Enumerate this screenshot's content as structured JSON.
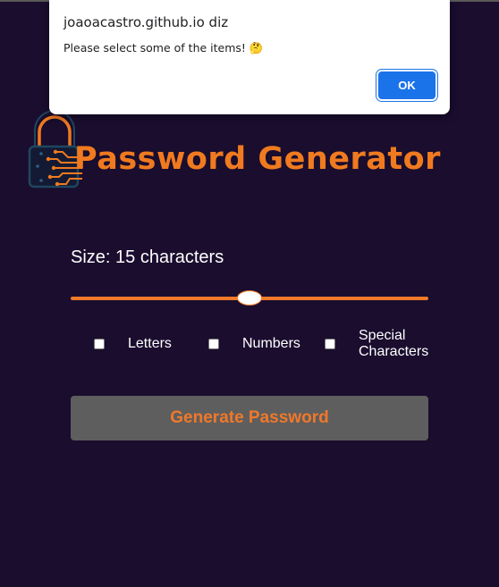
{
  "alert": {
    "origin": "joaoacastro.github.io diz",
    "message": "Please select some of the items! 🤔",
    "ok_label": "OK"
  },
  "logo": {
    "text": "Password Generator",
    "icon": "padlock-circuit-icon"
  },
  "size": {
    "label": "Size: 15 characters",
    "slider_fraction": 0.5
  },
  "options": [
    {
      "label": "Letters",
      "checked": false
    },
    {
      "label": "Numbers",
      "checked": false
    },
    {
      "label_line1": "Special",
      "label_line2": "Characters",
      "checked": false
    }
  ],
  "generate_label": "Generate Password",
  "colors": {
    "background": "#1a0d2e",
    "accent": "#f07a1f",
    "button_bg": "#5e5e5e",
    "alert_button": "#1a73e8"
  }
}
